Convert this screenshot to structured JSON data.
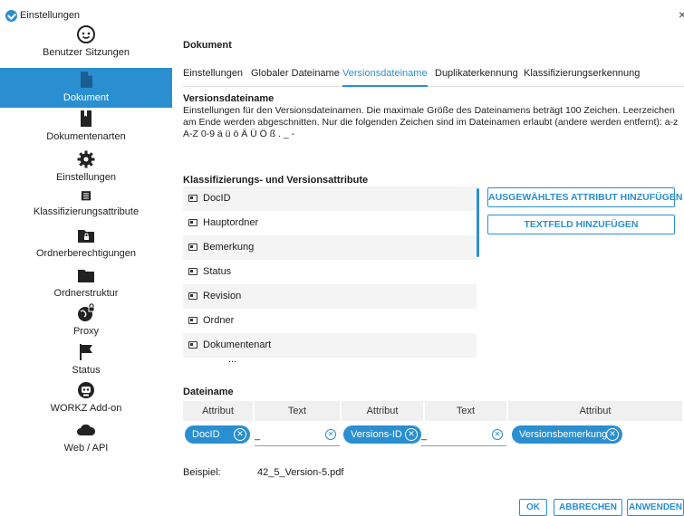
{
  "window": {
    "title": "Einstellungen",
    "close": "×"
  },
  "sidebar": {
    "items": [
      {
        "label": "Benutzer Sitzungen",
        "icon": "smiley-face-icon"
      },
      {
        "label": "Dokument",
        "icon": "document-icon",
        "active": true
      },
      {
        "label": "Dokumentenarten",
        "icon": "bookmark-icon"
      },
      {
        "label": "Einstellungen",
        "icon": "gear-icon"
      },
      {
        "label": "Klassifizierungsattribute",
        "icon": "tag-list-icon"
      },
      {
        "label": "Ordnerberechtigungen",
        "icon": "locked-folder-icon"
      },
      {
        "label": "Ordnerstruktur",
        "icon": "folder-icon"
      },
      {
        "label": "Proxy",
        "icon": "globe-lock-icon"
      },
      {
        "label": "Status",
        "icon": "flag-icon"
      },
      {
        "label": "WORKZ Add-on",
        "icon": "robot-icon"
      },
      {
        "label": "Web / API",
        "icon": "cloud-icon"
      }
    ]
  },
  "main": {
    "section_title": "Dokument",
    "tabs": [
      {
        "label": "Einstellungen"
      },
      {
        "label": "Globaler Dateiname"
      },
      {
        "label": "Versionsdateiname",
        "active": true
      },
      {
        "label": "Duplikaterkennung"
      },
      {
        "label": "Klassifizierungserkennung"
      }
    ],
    "subtitle": "Versionsdateiname",
    "description": "Einstellungen für den Versionsdateinamen. Die maximale Größe des Dateinamens beträgt 100 Zeichen. Leerzeichen am Ende werden abgeschnitten. Nur die folgenden Zeichen sind im Dateinamen erlaubt (andere werden entfernt): a-z A-Z 0-9 ä ü ö Ä Ü Ö ß . _ -",
    "attributes_title": "Klassifizierungs- und Versionsattribute",
    "attributes": [
      "DocID",
      "Hauptordner",
      "Bemerkung",
      "Status",
      "Revision",
      "Ordner",
      "Dokumentenart",
      "..."
    ],
    "add_attribute_button": "AUSGEWÄHLTES ATTRIBUT HINZUFÜGEN",
    "add_textfield_button": "TEXTFELD HINZUFÜGEN",
    "filename_title": "Dateiname",
    "filename_columns": [
      "Attribut",
      "Text",
      "Attribut",
      "Text",
      "Attribut"
    ],
    "filename_parts": [
      {
        "type": "attribute",
        "value": "DocID"
      },
      {
        "type": "text",
        "value": "_"
      },
      {
        "type": "attribute",
        "value": "Versions-ID"
      },
      {
        "type": "text",
        "value": "_"
      },
      {
        "type": "attribute",
        "value": "Versionsbemerkung"
      }
    ],
    "example_label": "Beispiel:",
    "example_value": "42_5_Version-5.pdf"
  },
  "footer": {
    "ok": "OK",
    "cancel": "ABBRECHEN",
    "apply": "ANWENDEN"
  },
  "colors": {
    "accent": "#2a8fd0",
    "row_alt": "#f4f4f4",
    "header_bg": "#f0f0f0"
  }
}
